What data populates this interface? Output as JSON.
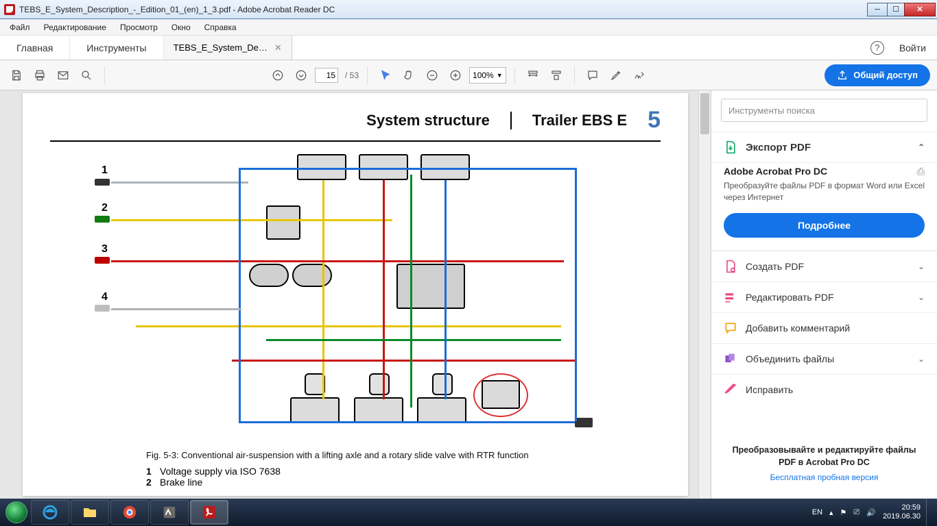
{
  "window": {
    "title": "TEBS_E_System_Description_-_Edition_01_(en)_1_3.pdf - Adobe Acrobat Reader DC"
  },
  "menu": {
    "items": [
      "Файл",
      "Редактирование",
      "Просмотр",
      "Окно",
      "Справка"
    ]
  },
  "tabs": {
    "home": "Главная",
    "tools": "Инструменты",
    "doc": "TEBS_E_System_De…",
    "signin": "Войти"
  },
  "toolbar": {
    "page_current": "15",
    "page_total": "/ 53",
    "zoom": "100%",
    "share": "Общий доступ"
  },
  "doc": {
    "section_title": "System structure",
    "product": "Trailer EBS E",
    "chapter": "5",
    "fig_caption": "Fig. 5-3:    Conventional air-suspension with a lifting axle and a rotary slide valve with RTR function",
    "legend": [
      {
        "n": "1",
        "t": "Voltage supply via ISO 7638"
      },
      {
        "n": "2",
        "t": "Brake line"
      }
    ],
    "labels": [
      "1",
      "2",
      "3",
      "4"
    ]
  },
  "panel": {
    "search_placeholder": "Инструменты поиска",
    "export_pdf": "Экспорт PDF",
    "pro_title": "Adobe Acrobat Pro DC",
    "pro_desc": "Преобразуйте файлы PDF в формат Word или Excel через Интернет",
    "learn_more": "Подробнее",
    "items": [
      {
        "label": "Создать PDF",
        "color": "#e84e8a"
      },
      {
        "label": "Редактировать PDF",
        "color": "#e84e8a"
      },
      {
        "label": "Добавить комментарий",
        "color": "#f2a100"
      },
      {
        "label": "Объединить файлы",
        "color": "#9050c8"
      },
      {
        "label": "Исправить",
        "color": "#e84e8a"
      }
    ],
    "footer_h": "Преобразовывайте и редактируйте файлы PDF в Acrobat Pro DC",
    "footer_link": "Бесплатная пробная версия"
  },
  "taskbar": {
    "lang": "EN",
    "time": "20:59",
    "date": "2019.06.30"
  }
}
